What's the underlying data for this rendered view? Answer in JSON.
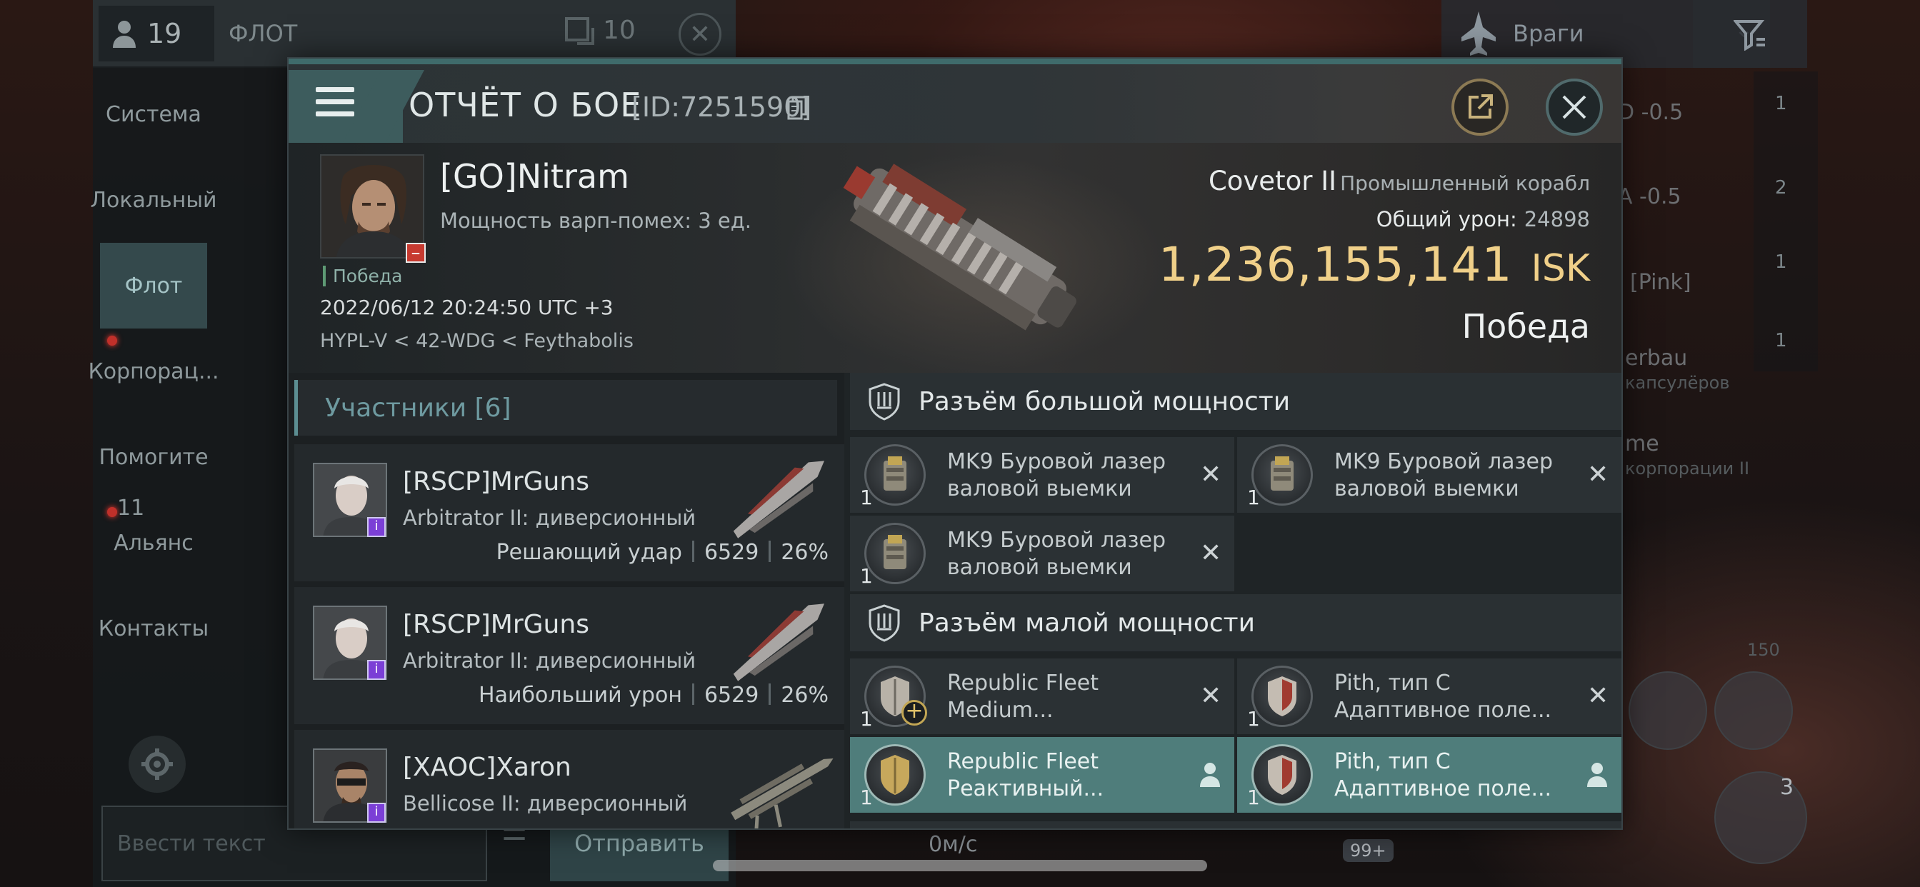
{
  "background": {
    "chat": {
      "member_count": "19",
      "fleet_label": "ФЛОТ",
      "top_right_count": "10",
      "channels": [
        {
          "label": "Система"
        },
        {
          "label": "Локальный"
        },
        {
          "label": "Флот"
        },
        {
          "label": "Корпорац..."
        },
        {
          "label": "Помогите"
        },
        {
          "label": "Альянс",
          "badge": "11"
        },
        {
          "label": "Контакты"
        }
      ],
      "input_placeholder": "Ввести текст",
      "send_label": "Отправить"
    },
    "enemies_label": "Враги",
    "overview_fragments": [
      "D -0.5",
      "A -0.5",
      "[Pink]",
      "erbau",
      "капсулёров",
      "me",
      "корпорации II"
    ],
    "right_column_counts": [
      "1",
      "2",
      "1",
      "1"
    ],
    "speed": "0м/с",
    "badge_99": "99+",
    "slot_badge": "3",
    "range_mark": "150"
  },
  "report": {
    "title": "ОТЧЁТ О БОЕ",
    "id": "[ID:7251590]",
    "victim": {
      "name": "[GO]Nitram",
      "warp_jammers": "Мощность варп-помех: 3 ед.",
      "victory_tag": "Победа",
      "datetime": "2022/06/12 20:24:50 UTC +3",
      "route": "HYPL-V < 42-WDG < Feythabolis",
      "ship_name": "Covetor II",
      "ship_class": "Промышленный корабл",
      "total_damage_label": "Общий урон:",
      "total_damage": "24898",
      "isk_value": "1,236,155,141",
      "isk_unit": "ISK",
      "result": "Победа"
    },
    "participants": {
      "header": "Участники [6]",
      "items": [
        {
          "name": "[RSCP]MrGuns",
          "ship": "Arbitrator II: диверсионный",
          "role": "Решающий удар",
          "damage": "6529",
          "percent": "26%"
        },
        {
          "name": "[RSCP]MrGuns",
          "ship": "Arbitrator II: диверсионный",
          "role": "Наибольший урон",
          "damage": "6529",
          "percent": "26%"
        },
        {
          "name": "[XAOC]Xaron",
          "ship": "Bellicose II: диверсионный",
          "role": "",
          "damage": "",
          "percent": ""
        }
      ]
    },
    "fitting": {
      "high_slots_label": "Разъём большой мощности",
      "high_slots": [
        {
          "qty": "1",
          "name_line1": "MK9 Буровой лазер",
          "name_line2": "валовой выемки",
          "state": "destroyed"
        },
        {
          "qty": "1",
          "name_line1": "MK9 Буровой лазер",
          "name_line2": "валовой выемки",
          "state": "destroyed"
        },
        {
          "qty": "1",
          "name_line1": "MK9 Буровой лазер",
          "name_line2": "валовой выемки",
          "state": "destroyed"
        }
      ],
      "low_slots_label": "Разъём малой мощности",
      "low_slots": [
        {
          "qty": "1",
          "name_line1": "Republic Fleet",
          "name_line2": "Medium...",
          "state": "destroyed"
        },
        {
          "qty": "1",
          "name_line1": "Pith, тип C",
          "name_line2": "Адаптивное поле...",
          "state": "destroyed"
        },
        {
          "qty": "1",
          "name_line1": "Republic Fleet",
          "name_line2": "Реактивный...",
          "state": "dropped"
        },
        {
          "qty": "1",
          "name_line1": "Pith, тип C",
          "name_line2": "Адаптивное поле...",
          "state": "dropped"
        }
      ]
    }
  },
  "colors": {
    "accent_teal": "#3d5c5d",
    "isk_gold": "#f0d089",
    "highlight_module": "#4f7d7b",
    "victory_green": "#5e9a74"
  }
}
